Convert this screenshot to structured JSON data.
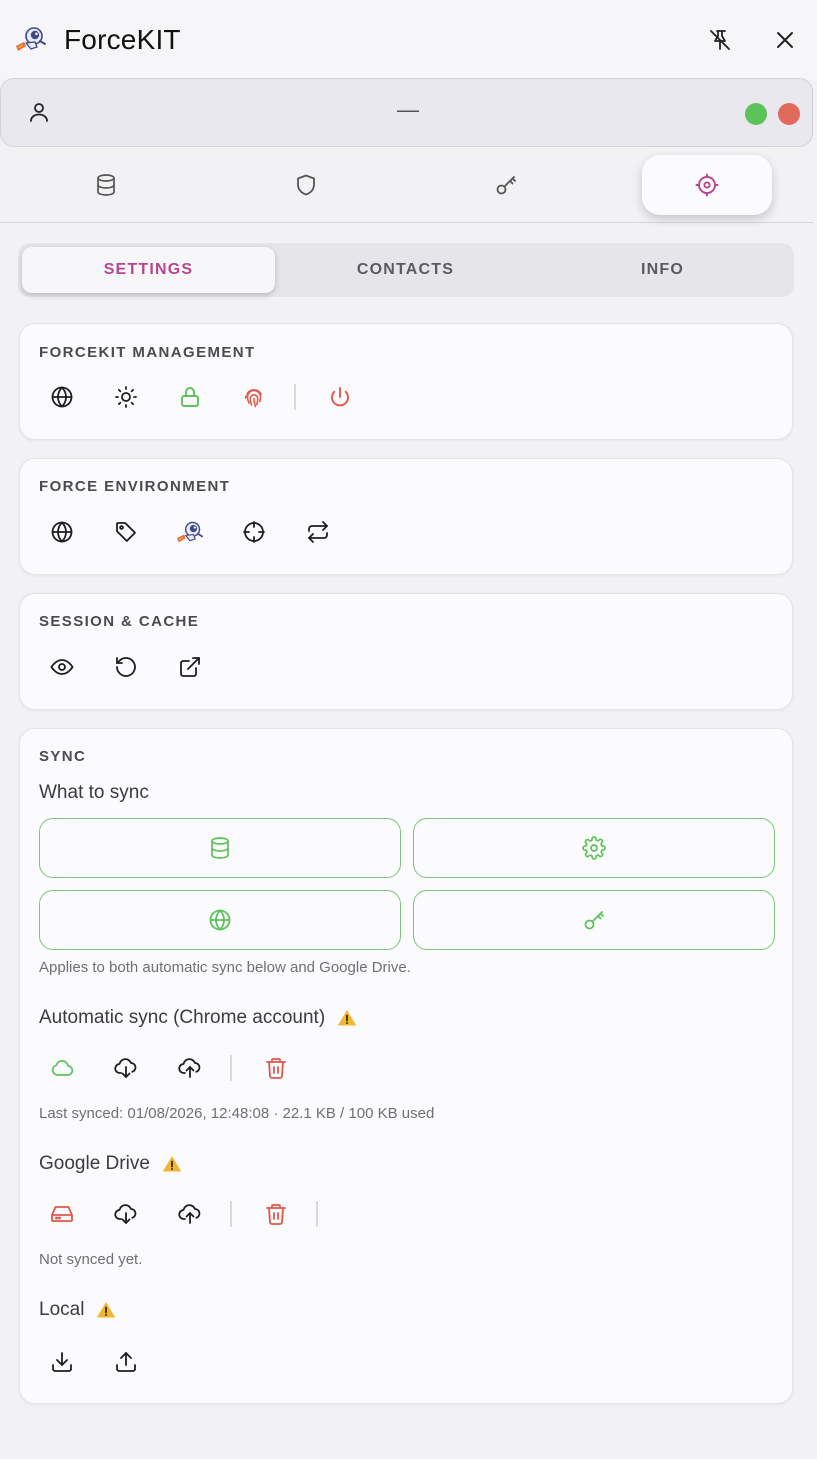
{
  "app": {
    "title": "ForceKIT"
  },
  "user": {
    "name": "—"
  },
  "colors": {
    "accent": "#b5478e",
    "green": "#5cc35a",
    "red": "#e0584a"
  },
  "main_nav": [
    "database-icon",
    "shield-icon",
    "key-icon",
    "settings-icon"
  ],
  "tabs": [
    {
      "label": "SETTINGS",
      "active": true
    },
    {
      "label": "CONTACTS",
      "active": false
    },
    {
      "label": "INFO",
      "active": false
    }
  ],
  "sections": {
    "management": {
      "title": "FORCEKIT MANAGEMENT"
    },
    "environment": {
      "title": "FORCE ENVIRONMENT"
    },
    "session": {
      "title": "SESSION & CACHE"
    },
    "sync": {
      "title": "SYNC",
      "what_to_sync": "What to sync",
      "applies_note": "Applies to both automatic sync below and Google Drive.",
      "automatic": {
        "title": "Automatic sync (Chrome account)",
        "status": "Last synced: 01/08/2026, 12:48:08 · 22.1 KB / 100 KB used"
      },
      "drive": {
        "title": "Google Drive",
        "status": "Not synced yet."
      },
      "local": {
        "title": "Local"
      }
    }
  }
}
